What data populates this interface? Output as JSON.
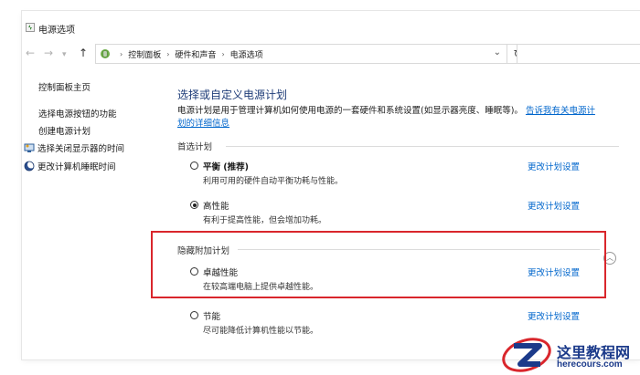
{
  "window": {
    "title": "电源选项"
  },
  "nav": {
    "back": "←",
    "forward": "→",
    "dropdown": "▾",
    "up": "↑",
    "breadcrumbs": [
      "控制面板",
      "硬件和声音",
      "电源选项"
    ],
    "breadcrumb_separator": "›",
    "address_dropdown": "⌄",
    "refresh": "↻",
    "search_placeholder": ""
  },
  "sidebar": {
    "items": [
      {
        "label": "控制面板主页",
        "icon": null
      },
      {
        "label": "选择电源按钮的功能",
        "icon": null
      },
      {
        "label": "创建电源计划",
        "icon": null
      },
      {
        "label": "选择关闭显示器的时间",
        "icon": "monitor-icon"
      },
      {
        "label": "更改计算机睡眠时间",
        "icon": "moon-icon"
      }
    ]
  },
  "main": {
    "title": "选择或自定义电源计划",
    "description": "电源计划是用于管理计算机如何使用电源的一套硬件和系统设置(如显示器亮度、睡眠等)。",
    "description_link": "告诉我有关电源计划的详细信息",
    "preferred_label": "首选计划",
    "hidden_label": "隐藏附加计划",
    "collapse_symbol": "︿",
    "change_settings": "更改计划设置",
    "plans": [
      {
        "name": "平衡 (推荐)",
        "desc": "利用可用的硬件自动平衡功耗与性能。",
        "checked": false
      },
      {
        "name": "高性能",
        "desc": "有利于提高性能，但会增加功耗。",
        "checked": true
      },
      {
        "name": "卓越性能",
        "desc": "在较高端电脑上提供卓越性能。",
        "checked": false
      },
      {
        "name": "节能",
        "desc": "尽可能降低计算机性能以节能。",
        "checked": false
      }
    ]
  },
  "watermark": {
    "title": "这里教程网",
    "subtitle": "herecours.com"
  },
  "colors": {
    "accent_link": "#0066cc",
    "title_blue": "#1e3c78",
    "highlight_red": "#d9262c",
    "watermark_blue": "#1b3a8a"
  }
}
